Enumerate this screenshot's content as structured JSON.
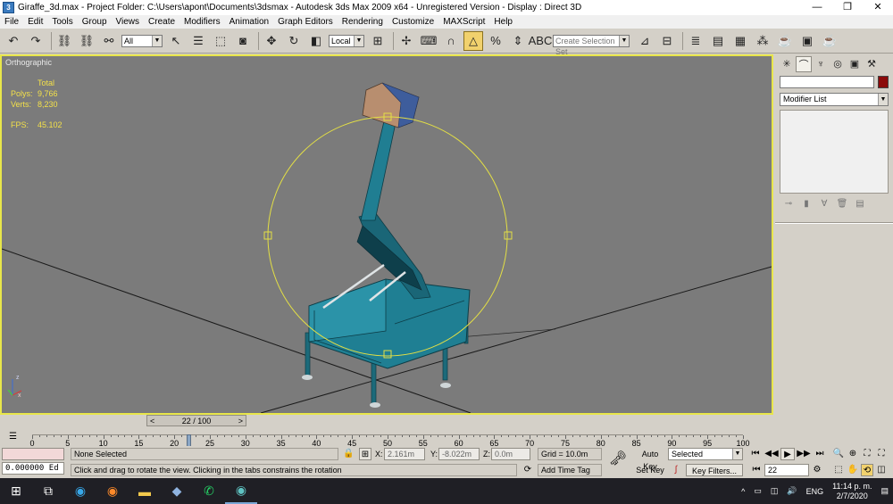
{
  "window": {
    "title": "Giraffe_3d.max     - Project Folder: C:\\Users\\apont\\Documents\\3dsmax     - Autodesk 3ds Max  2009 x64    - Unregistered Version     - Display : Direct 3D",
    "minimize": "—",
    "maximize": "❐",
    "close": "✕"
  },
  "menu": [
    "File",
    "Edit",
    "Tools",
    "Group",
    "Views",
    "Create",
    "Modifiers",
    "Animation",
    "Graph Editors",
    "Rendering",
    "Customize",
    "MAXScript",
    "Help"
  ],
  "toolbar": {
    "selection_filter": "All",
    "reference_coord": "Local",
    "named_selection_placeholder": "Create Selection Set"
  },
  "viewport": {
    "label": "Orthographic",
    "stats": {
      "header": "Total",
      "polys_label": "Polys:",
      "polys": "9,766",
      "verts_label": "Verts:",
      "verts": "8,230",
      "fps_label": "FPS:",
      "fps": "45.102"
    },
    "axis_z": "z",
    "axis_x": "x"
  },
  "command_panel": {
    "modifier_list": "Modifier List",
    "object_color": "#8b0a0a"
  },
  "time": {
    "frame_display": "22 / 100",
    "prev": "<",
    "next": ">",
    "current_frame": 22,
    "total_frames": 100,
    "ticks": [
      0,
      5,
      10,
      15,
      20,
      25,
      30,
      35,
      40,
      45,
      50,
      55,
      60,
      65,
      70,
      75,
      80,
      85,
      90,
      95,
      100
    ]
  },
  "status": {
    "script_value": "0.000000",
    "script_suffix": "Ed",
    "selection": "None Selected",
    "prompt": "Click and drag to rotate the view.  Clicking in the tabs constrains the rotation",
    "x_label": "X:",
    "x_value": "2.161m",
    "y_label": "Y:",
    "y_value": "-8.022m",
    "z_label": "Z:",
    "z_value": "0.0m",
    "grid": "Grid = 10.0m",
    "add_time_tag": "Add Time Tag",
    "auto_key": "Auto Key",
    "set_key": "Set Key",
    "key_mode": "Selected",
    "key_filters": "Key Filters...",
    "frame_field": "22"
  },
  "taskbar": {
    "language": "ENG",
    "time": "11:14 p. m.",
    "date": "2/7/2020"
  }
}
